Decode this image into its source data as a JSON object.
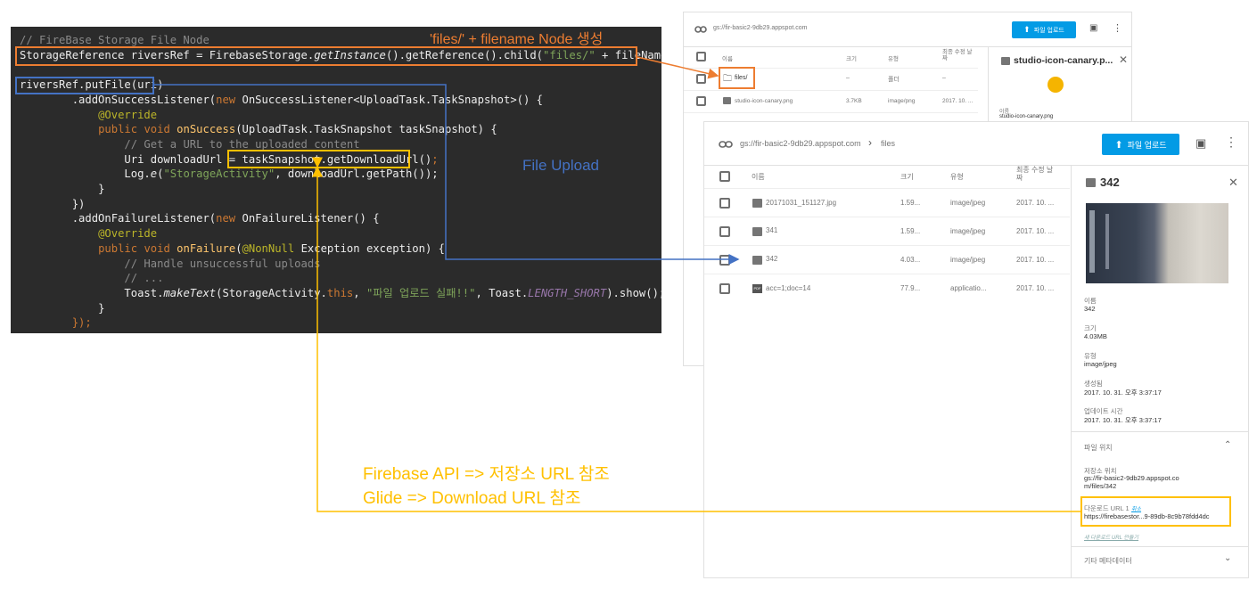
{
  "code": {
    "comment_node": "// FireBase Storage File Node",
    "line_ref_a": "StorageReference riversRef = FirebaseStorage.",
    "line_ref_method": "getInstance",
    "line_ref_b": "().getReference().child(",
    "line_ref_str": "\"files/\"",
    "line_ref_c": " + fileName);",
    "line_put": "riversRef.putFile(uri)",
    "line_add_success_a": "        .addOnSuccessListener(",
    "kw_new": "new",
    "line_add_success_b": " OnSuccessListener<UploadTask.TaskSnapshot>() {",
    "override": "@Override",
    "kw_public": "public",
    "kw_void": "void",
    "on_success": "onSuccess",
    "on_success_params": "(UploadTask.TaskSnapshot taskSnapshot) {",
    "comment_get_url": "// Get a URL to the uploaded content",
    "uri_decl": "Uri downloadUrl = ",
    "task_download": "taskSnapshot.getDownloadUrl()",
    "semicolon": ";",
    "log_a": "Log.",
    "log_e": "e",
    "log_b": "(",
    "log_str": "\"StorageActivity\"",
    "log_c": ", downloadUrl.getPath());",
    "close_brace": "}",
    "close_paren": "})",
    "line_add_failure_a": "        .addOnFailureListener(",
    "line_add_failure_b": " OnFailureListener() {",
    "on_failure": "onFailure",
    "non_null": "@NonNull",
    "on_failure_params": " Exception exception) {",
    "comment_handle": "// Handle unsuccessful uploads",
    "comment_dots": "// ...",
    "toast_a": "Toast.",
    "toast_make": "makeText",
    "toast_b": "(StorageActivity.",
    "kw_this": "this",
    "toast_c": ", ",
    "toast_str": "\"파일 업로드 실패!!\"",
    "toast_d": ", Toast.",
    "toast_const": "LENGTH_SHORT",
    "toast_e": ").show();",
    "end": "});"
  },
  "annotations": {
    "files_node": "'files/' + filename Node 생성",
    "file_upload": "File Upload",
    "firebase_api": "Firebase API => 저장소 URL 참조",
    "glide": "Glide => Download URL 참조"
  },
  "colors": {
    "orange": "#ed7d31",
    "blue": "#4472c4",
    "yellow": "#ffc000",
    "accent": "#039be5"
  },
  "console_back": {
    "path": "gs://fir-basic2-9db29.appspot.com",
    "upload_label": "파일 업로드",
    "columns": {
      "name": "이름",
      "size": "크기",
      "type": "유형",
      "modified": "최종 수정 날짜"
    },
    "rows": [
      {
        "icon": "folder-icon",
        "name": "files/",
        "size": "–",
        "type": "폴더",
        "modified": "–"
      },
      {
        "icon": "image-icon",
        "name": "studio-icon-canary.png",
        "size": "3.7KB",
        "type": "image/png",
        "modified": "2017. 10. ..."
      }
    ],
    "detail_title": "studio-icon-canary.p...",
    "detail_name_label": "이름",
    "detail_name_value": "studio-icon-canary.png"
  },
  "console_front": {
    "path_root": "gs://fir-basic2-9db29.appspot.com",
    "path_sep": "›",
    "path_folder": "files",
    "upload_label": "파일 업로드",
    "columns": {
      "name": "이름",
      "size": "크기",
      "type": "유형",
      "modified": "최종 수정 날짜"
    },
    "rows": [
      {
        "icon": "image-icon",
        "name": "20171031_151127.jpg",
        "size": "1.59...",
        "type": "image/jpeg",
        "modified": "2017. 10. ..."
      },
      {
        "icon": "image-icon",
        "name": "341",
        "size": "1.59...",
        "type": "image/jpeg",
        "modified": "2017. 10. ..."
      },
      {
        "icon": "image-icon",
        "name": "342",
        "size": "4.03...",
        "type": "image/jpeg",
        "modified": "2017. 10. ..."
      },
      {
        "icon": "pdf-icon",
        "name": "acc=1;doc=14",
        "size": "77.9...",
        "type": "applicatio...",
        "modified": "2017. 10. ..."
      }
    ],
    "detail": {
      "title": "342",
      "fields": [
        {
          "label": "이름",
          "value": "342"
        },
        {
          "label": "크기",
          "value": "4.03MB"
        },
        {
          "label": "유형",
          "value": "image/jpeg"
        },
        {
          "label": "생성됨",
          "value": "2017. 10. 31. 오후 3:37:17"
        },
        {
          "label": "업데이트 시간",
          "value": "2017. 10. 31. 오후 3:37:17"
        }
      ],
      "location_section": "파일 위치",
      "storage_location_label": "저장소 위치",
      "storage_location_value": "gs://fir-basic2-9db29.appspot.com/files/342",
      "download_url_label": "다운로드 URL 1",
      "download_url_remove": "취소",
      "download_url_value": "https://firebasestor...9-89db-8c9b78fdd4dc",
      "new_url_link": "새 다운로드 URL 만들기",
      "other_metadata": "기타 메타데이터"
    }
  }
}
